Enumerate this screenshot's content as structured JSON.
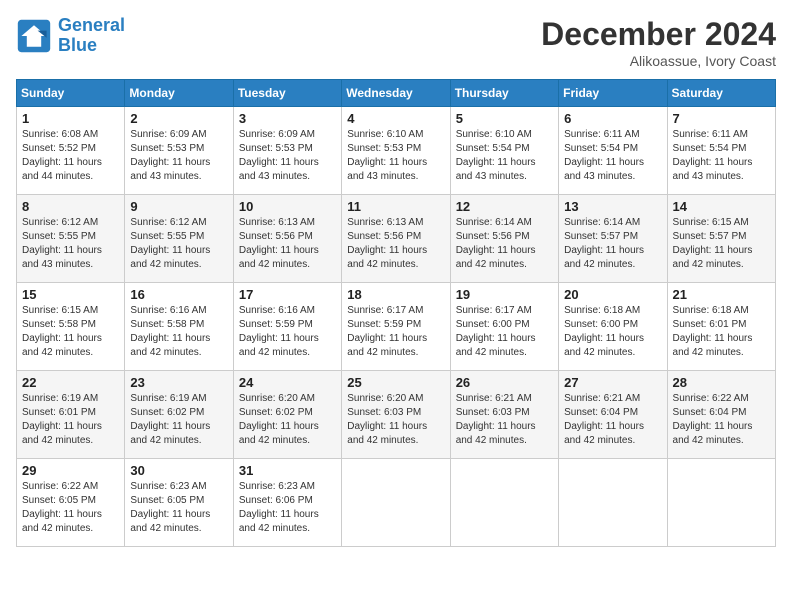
{
  "logo": {
    "name": "GeneralBlue",
    "part1": "General",
    "part2": "Blue"
  },
  "header": {
    "month": "December 2024",
    "location": "Alikoassue, Ivory Coast"
  },
  "weekdays": [
    "Sunday",
    "Monday",
    "Tuesday",
    "Wednesday",
    "Thursday",
    "Friday",
    "Saturday"
  ],
  "weeks": [
    [
      {
        "day": "1",
        "info": "Sunrise: 6:08 AM\nSunset: 5:52 PM\nDaylight: 11 hours and 44 minutes."
      },
      {
        "day": "2",
        "info": "Sunrise: 6:09 AM\nSunset: 5:53 PM\nDaylight: 11 hours and 43 minutes."
      },
      {
        "day": "3",
        "info": "Sunrise: 6:09 AM\nSunset: 5:53 PM\nDaylight: 11 hours and 43 minutes."
      },
      {
        "day": "4",
        "info": "Sunrise: 6:10 AM\nSunset: 5:53 PM\nDaylight: 11 hours and 43 minutes."
      },
      {
        "day": "5",
        "info": "Sunrise: 6:10 AM\nSunset: 5:54 PM\nDaylight: 11 hours and 43 minutes."
      },
      {
        "day": "6",
        "info": "Sunrise: 6:11 AM\nSunset: 5:54 PM\nDaylight: 11 hours and 43 minutes."
      },
      {
        "day": "7",
        "info": "Sunrise: 6:11 AM\nSunset: 5:54 PM\nDaylight: 11 hours and 43 minutes."
      }
    ],
    [
      {
        "day": "8",
        "info": "Sunrise: 6:12 AM\nSunset: 5:55 PM\nDaylight: 11 hours and 43 minutes."
      },
      {
        "day": "9",
        "info": "Sunrise: 6:12 AM\nSunset: 5:55 PM\nDaylight: 11 hours and 42 minutes."
      },
      {
        "day": "10",
        "info": "Sunrise: 6:13 AM\nSunset: 5:56 PM\nDaylight: 11 hours and 42 minutes."
      },
      {
        "day": "11",
        "info": "Sunrise: 6:13 AM\nSunset: 5:56 PM\nDaylight: 11 hours and 42 minutes."
      },
      {
        "day": "12",
        "info": "Sunrise: 6:14 AM\nSunset: 5:56 PM\nDaylight: 11 hours and 42 minutes."
      },
      {
        "day": "13",
        "info": "Sunrise: 6:14 AM\nSunset: 5:57 PM\nDaylight: 11 hours and 42 minutes."
      },
      {
        "day": "14",
        "info": "Sunrise: 6:15 AM\nSunset: 5:57 PM\nDaylight: 11 hours and 42 minutes."
      }
    ],
    [
      {
        "day": "15",
        "info": "Sunrise: 6:15 AM\nSunset: 5:58 PM\nDaylight: 11 hours and 42 minutes."
      },
      {
        "day": "16",
        "info": "Sunrise: 6:16 AM\nSunset: 5:58 PM\nDaylight: 11 hours and 42 minutes."
      },
      {
        "day": "17",
        "info": "Sunrise: 6:16 AM\nSunset: 5:59 PM\nDaylight: 11 hours and 42 minutes."
      },
      {
        "day": "18",
        "info": "Sunrise: 6:17 AM\nSunset: 5:59 PM\nDaylight: 11 hours and 42 minutes."
      },
      {
        "day": "19",
        "info": "Sunrise: 6:17 AM\nSunset: 6:00 PM\nDaylight: 11 hours and 42 minutes."
      },
      {
        "day": "20",
        "info": "Sunrise: 6:18 AM\nSunset: 6:00 PM\nDaylight: 11 hours and 42 minutes."
      },
      {
        "day": "21",
        "info": "Sunrise: 6:18 AM\nSunset: 6:01 PM\nDaylight: 11 hours and 42 minutes."
      }
    ],
    [
      {
        "day": "22",
        "info": "Sunrise: 6:19 AM\nSunset: 6:01 PM\nDaylight: 11 hours and 42 minutes."
      },
      {
        "day": "23",
        "info": "Sunrise: 6:19 AM\nSunset: 6:02 PM\nDaylight: 11 hours and 42 minutes."
      },
      {
        "day": "24",
        "info": "Sunrise: 6:20 AM\nSunset: 6:02 PM\nDaylight: 11 hours and 42 minutes."
      },
      {
        "day": "25",
        "info": "Sunrise: 6:20 AM\nSunset: 6:03 PM\nDaylight: 11 hours and 42 minutes."
      },
      {
        "day": "26",
        "info": "Sunrise: 6:21 AM\nSunset: 6:03 PM\nDaylight: 11 hours and 42 minutes."
      },
      {
        "day": "27",
        "info": "Sunrise: 6:21 AM\nSunset: 6:04 PM\nDaylight: 11 hours and 42 minutes."
      },
      {
        "day": "28",
        "info": "Sunrise: 6:22 AM\nSunset: 6:04 PM\nDaylight: 11 hours and 42 minutes."
      }
    ],
    [
      {
        "day": "29",
        "info": "Sunrise: 6:22 AM\nSunset: 6:05 PM\nDaylight: 11 hours and 42 minutes."
      },
      {
        "day": "30",
        "info": "Sunrise: 6:23 AM\nSunset: 6:05 PM\nDaylight: 11 hours and 42 minutes."
      },
      {
        "day": "31",
        "info": "Sunrise: 6:23 AM\nSunset: 6:06 PM\nDaylight: 11 hours and 42 minutes."
      },
      null,
      null,
      null,
      null
    ]
  ]
}
